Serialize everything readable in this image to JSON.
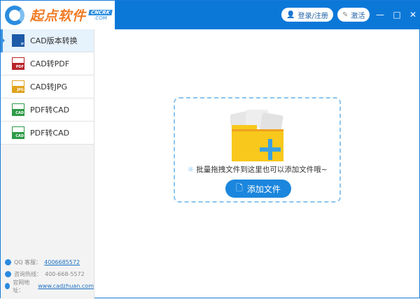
{
  "header": {
    "logo_text": "起点软件",
    "logo_badge_top": "CNCRK",
    "logo_badge_bottom": ".COM",
    "login_label": "登录/注册",
    "activate_label": "激活",
    "minimize": "—",
    "maximize": "□",
    "close": "✕"
  },
  "sidebar": {
    "items": [
      {
        "label": "CAD版本转换",
        "icon_text": "",
        "color": "#1d5aa8"
      },
      {
        "label": "CAD转PDF",
        "icon_text": "PDF",
        "color": "#b8242a"
      },
      {
        "label": "CAD转JPG",
        "icon_text": "JPG",
        "color": "#e0a21c"
      },
      {
        "label": "PDF转CAD",
        "icon_text": "CAD",
        "color": "#2e9a48"
      },
      {
        "label": "PDF转CAD",
        "icon_text": "CAD",
        "color": "#2e9a48"
      }
    ],
    "qq_label": "QQ 客服：",
    "qq_value": "4006685572",
    "hotline_label": "咨询热线：",
    "hotline_value": "400-668-5572",
    "site_label": "官网地址：",
    "site_value": "www.cadzhuan.com"
  },
  "main": {
    "tip": "批量拖拽文件到这里也可以添加文件哦~",
    "add_file_label": "添加文件"
  }
}
